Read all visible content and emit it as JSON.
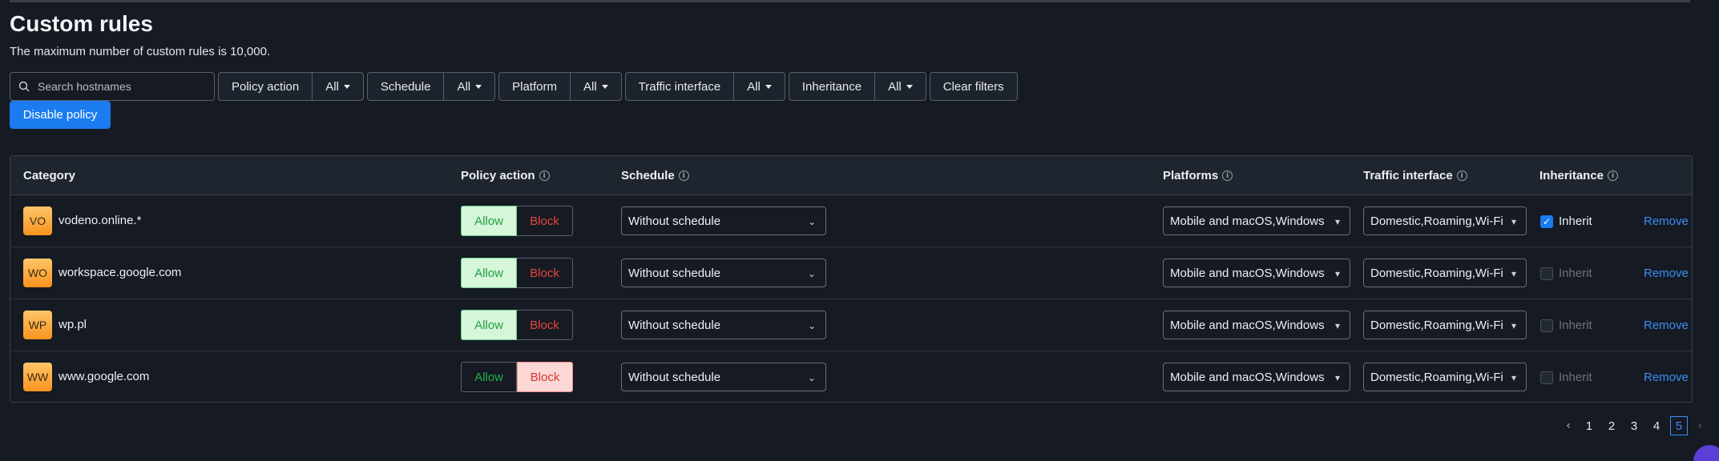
{
  "page": {
    "title": "Custom rules",
    "subtitle": "The maximum number of custom rules is 10,000."
  },
  "filters": {
    "search_placeholder": "Search hostnames",
    "groups": [
      {
        "label": "Policy action",
        "value": "All"
      },
      {
        "label": "Schedule",
        "value": "All"
      },
      {
        "label": "Platform",
        "value": "All"
      },
      {
        "label": "Traffic interface",
        "value": "All"
      },
      {
        "label": "Inheritance",
        "value": "All"
      }
    ],
    "clear_label": "Clear filters"
  },
  "actions": {
    "disable_policy": "Disable policy"
  },
  "table": {
    "headers": {
      "category": "Category",
      "policy_action": "Policy action",
      "schedule": "Schedule",
      "platforms": "Platforms",
      "traffic_interface": "Traffic interface",
      "inheritance": "Inheritance"
    },
    "allow_label": "Allow",
    "block_label": "Block",
    "inherit_label": "Inherit",
    "remove_label": "Remove",
    "rows": [
      {
        "initials": "VO",
        "host": "vodeno.online.*",
        "action": "allow",
        "schedule": "Without schedule",
        "platforms": "Mobile and macOS,Windows",
        "traffic": "Domestic,Roaming,Wi-Fi",
        "inherit": true
      },
      {
        "initials": "WO",
        "host": "workspace.google.com",
        "action": "allow",
        "schedule": "Without schedule",
        "platforms": "Mobile and macOS,Windows",
        "traffic": "Domestic,Roaming,Wi-Fi",
        "inherit": false
      },
      {
        "initials": "WP",
        "host": "wp.pl",
        "action": "allow",
        "schedule": "Without schedule",
        "platforms": "Mobile and macOS,Windows",
        "traffic": "Domestic,Roaming,Wi-Fi",
        "inherit": false
      },
      {
        "initials": "WW",
        "host": "www.google.com",
        "action": "block",
        "schedule": "Without schedule",
        "platforms": "Mobile and macOS,Windows",
        "traffic": "Domestic,Roaming,Wi-Fi",
        "inherit": false
      }
    ]
  },
  "pagination": {
    "pages": [
      "1",
      "2",
      "3",
      "4",
      "5"
    ],
    "current": "5"
  },
  "colors": {
    "background": "#151a23",
    "accent": "#1b7cf0",
    "allow": "#21b14a",
    "block": "#e8453c",
    "link": "#3d8ef5"
  }
}
